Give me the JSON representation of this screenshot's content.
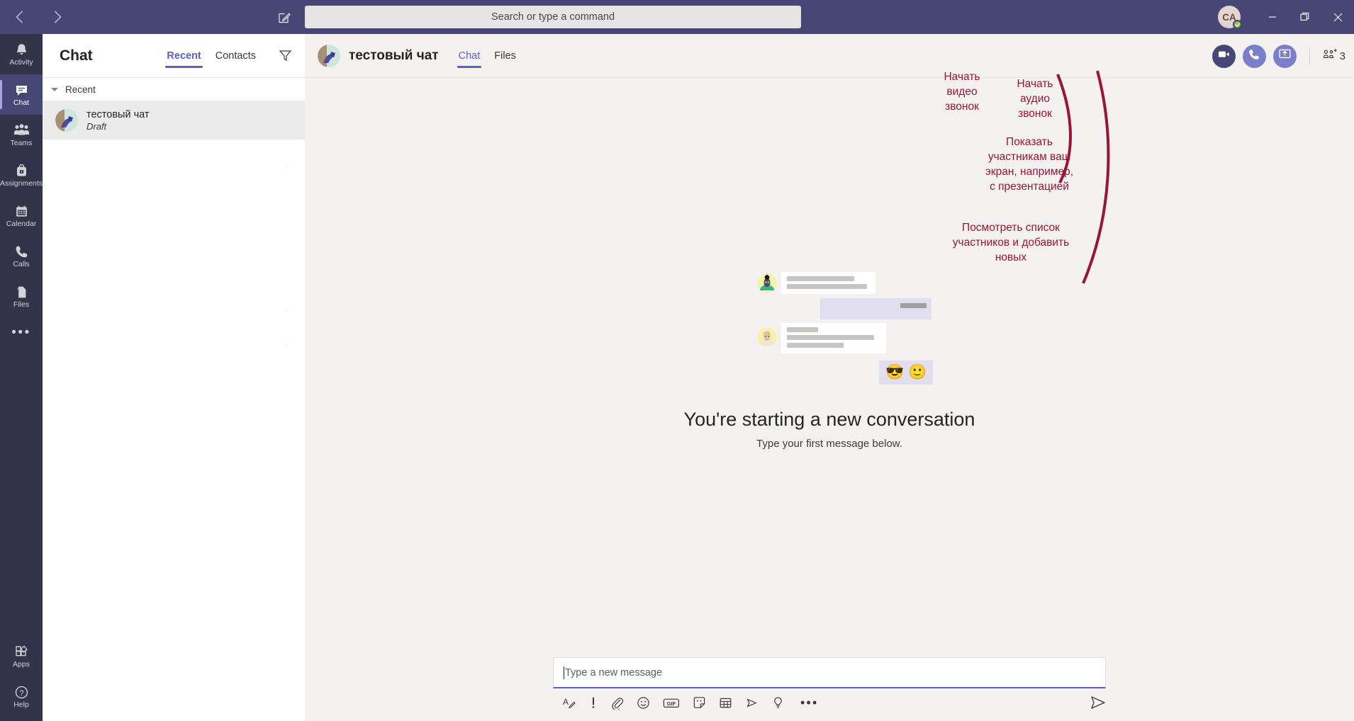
{
  "titlebar": {
    "back_icon": "chevron-left-icon",
    "forward_icon": "chevron-right-icon",
    "compose_icon": "compose-new-chat-icon",
    "search_placeholder": "Search or type a command",
    "avatar_initials": "CA",
    "presence": "available",
    "minimize_label": "Minimize",
    "maximize_label": "Restore",
    "close_label": "Close"
  },
  "rail": {
    "items": [
      {
        "label": "Activity",
        "icon": "bell-icon",
        "active": false
      },
      {
        "label": "Chat",
        "icon": "chat-bubble-icon",
        "active": true
      },
      {
        "label": "Teams",
        "icon": "people-icon",
        "active": false
      },
      {
        "label": "Assignments",
        "icon": "backpack-icon",
        "active": false
      },
      {
        "label": "Calendar",
        "icon": "calendar-icon",
        "active": false
      },
      {
        "label": "Calls",
        "icon": "phone-icon",
        "active": false
      },
      {
        "label": "Files",
        "icon": "file-icon",
        "active": false
      }
    ],
    "more_label": "•••",
    "bottom": [
      {
        "label": "Apps",
        "icon": "apps-icon"
      },
      {
        "label": "Help",
        "icon": "help-icon"
      }
    ]
  },
  "chatlist": {
    "title": "Chat",
    "tabs": [
      {
        "label": "Recent",
        "active": true
      },
      {
        "label": "Contacts",
        "active": false
      }
    ],
    "filter_icon": "filter-icon",
    "group_label": "Recent",
    "items": [
      {
        "name": "тестовый чат",
        "sub": "Draft",
        "selected": true
      }
    ]
  },
  "chat_header": {
    "title": "тестовый чат",
    "tabs": [
      {
        "label": "Chat",
        "active": true
      },
      {
        "label": "Files",
        "active": false
      }
    ],
    "actions": [
      {
        "name": "video-call-button",
        "icon": "video-icon",
        "style": "dark"
      },
      {
        "name": "audio-call-button",
        "icon": "phone-icon",
        "style": "light"
      },
      {
        "name": "share-screen-button",
        "icon": "share-screen-icon",
        "style": "light"
      }
    ],
    "people_count": "3",
    "people_icon": "add-people-icon"
  },
  "empty_state": {
    "title": "You're starting a new conversation",
    "subtitle": "Type your first message below.",
    "illustration": {
      "emoji_bubble": [
        "😎",
        "🙂"
      ]
    }
  },
  "compose": {
    "placeholder": "Type a new message",
    "tools": [
      {
        "name": "format-button",
        "icon": "format-text-icon",
        "glyph": "A"
      },
      {
        "name": "priority-button",
        "icon": "important-icon",
        "glyph": "!"
      },
      {
        "name": "attach-button",
        "icon": "paperclip-icon"
      },
      {
        "name": "emoji-button",
        "icon": "emoji-icon"
      },
      {
        "name": "giphy-button",
        "icon": "gif-icon",
        "glyph": "GIF"
      },
      {
        "name": "sticker-button",
        "icon": "sticker-icon"
      },
      {
        "name": "meeting-button",
        "icon": "meet-now-icon"
      },
      {
        "name": "stream-button",
        "icon": "stream-icon"
      },
      {
        "name": "praise-button",
        "icon": "praise-icon"
      },
      {
        "name": "more-options-button",
        "icon": "ellipsis-icon",
        "glyph": "•••"
      }
    ],
    "send_icon": "send-icon"
  },
  "annotations": {
    "color": "#9b1436",
    "items": [
      {
        "id": "video",
        "text": "Начать\nвидео\nзвонок"
      },
      {
        "id": "audio",
        "text": "Начать\nаудио\nзвонок"
      },
      {
        "id": "share",
        "text": "Показать\nучастникам ваш\nэкран, например,\nс презентацией"
      },
      {
        "id": "people",
        "text": "Посмотреть список\nучастников и добавить\nновых"
      }
    ]
  }
}
